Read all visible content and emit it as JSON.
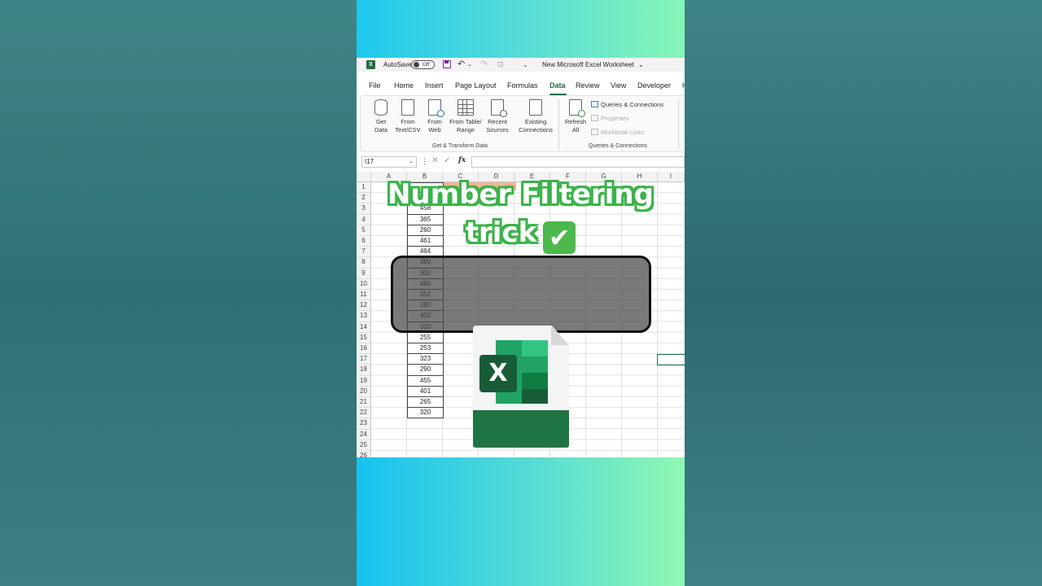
{
  "titlebar": {
    "autosave_label": "AutoSave",
    "autosave_state": "Off",
    "document_title": "New Microsoft Excel Worksheet"
  },
  "menu": {
    "tabs": [
      "File",
      "Home",
      "Insert",
      "Page Layout",
      "Formulas",
      "Data",
      "Review",
      "View",
      "Developer",
      "H"
    ],
    "active_tab": "Data"
  },
  "ribbon": {
    "buttons": {
      "get_data": "Get\nData",
      "from_text_csv": "From\nText/CSV",
      "from_web": "From\nWeb",
      "from_table_range": "From Table/\nRange",
      "recent_sources": "Recent\nSources",
      "existing_connections": "Existing\nConnections",
      "refresh_all": "Refresh\nAll"
    },
    "small_buttons": {
      "queries_connections": "Queries & Connections",
      "properties": "Properties",
      "workbook_links": "Workbook Links"
    },
    "groups": {
      "get_transform": "Get & Transform Data",
      "queries_connections": "Queries & Connections"
    }
  },
  "formula_bar": {
    "name_box": "I17",
    "fx": "fx",
    "value": ""
  },
  "sheet": {
    "columns": [
      "A",
      "B",
      "C",
      "D",
      "E",
      "F",
      "G",
      "H",
      "I"
    ],
    "rows": [
      "1",
      "2",
      "3",
      "4",
      "5",
      "6",
      "7",
      "8",
      "9",
      "10",
      "11",
      "12",
      "13",
      "14",
      "15",
      "16",
      "17",
      "18",
      "19",
      "20",
      "21",
      "22",
      "23",
      "24",
      "25",
      "26"
    ],
    "selected_cell": "I17",
    "column_b_values": [
      "",
      "",
      "458",
      "365",
      "260",
      "461",
      "464",
      "380",
      "300",
      "460",
      "252",
      "280",
      "402",
      "320",
      "255",
      "253",
      "323",
      "290",
      "455",
      "401",
      "265",
      "320"
    ]
  },
  "overlay": {
    "title_line1": "Number Filtering",
    "title_line2": "trick",
    "check_emoji": "✔",
    "logo_letter": "X"
  },
  "colors": {
    "accent_green": "#1e7145",
    "title_outline": "#3bb34a",
    "excel_dark": "#185c37"
  }
}
